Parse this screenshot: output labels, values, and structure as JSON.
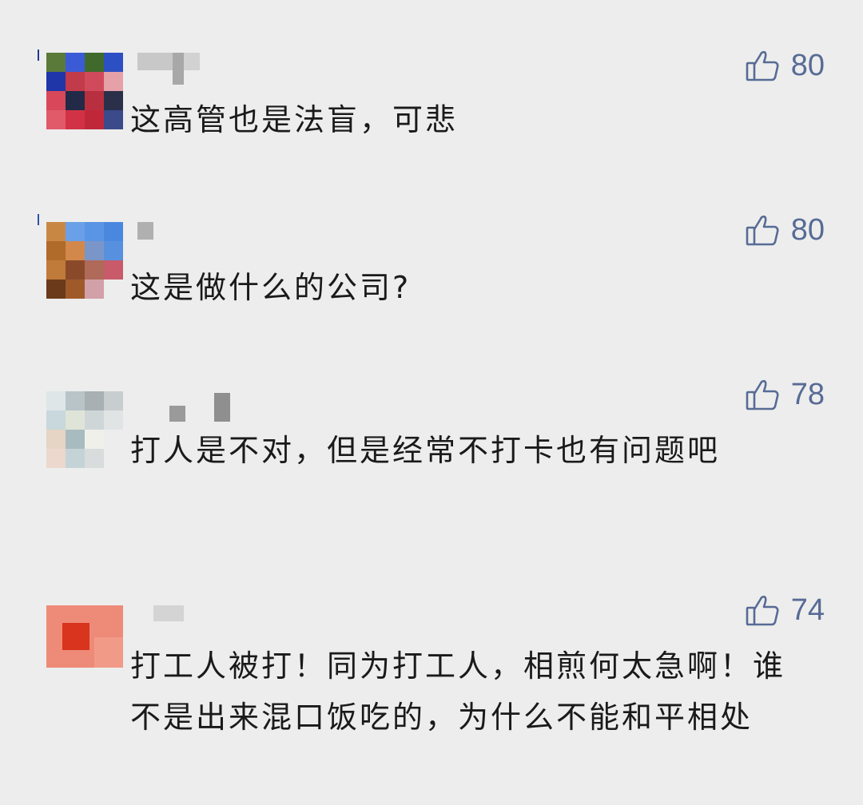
{
  "comments": [
    {
      "likes": "80",
      "text": "这高管也是法盲，可悲"
    },
    {
      "likes": "80",
      "text": "这是做什么的公司?"
    },
    {
      "likes": "78",
      "text": "打人是不对，但是经常不打卡也有问题吧"
    },
    {
      "likes": "74",
      "text": "打工人被打！同为打工人，相煎何太急啊！谁不是出来混口饭吃的，为什么不能和平相处"
    }
  ],
  "colors": {
    "background": "#ededed",
    "accent_blue": "#576b95",
    "text": "#1a1a1a"
  },
  "icons": {
    "like": "thumbs-up-outline-icon"
  }
}
